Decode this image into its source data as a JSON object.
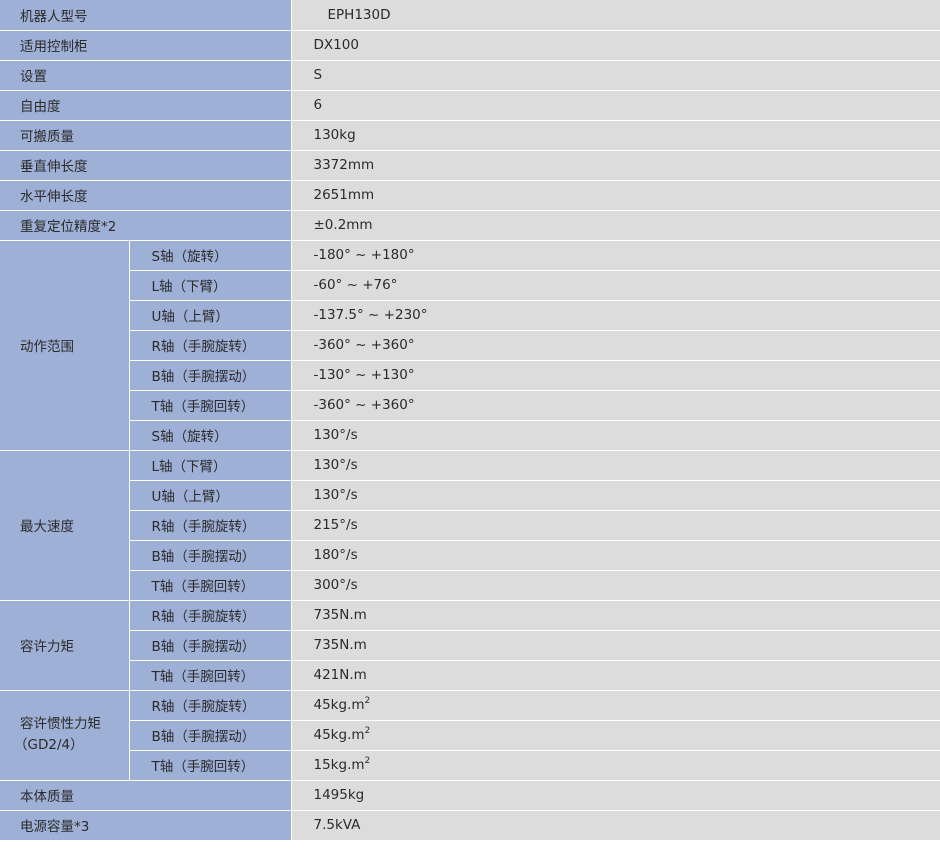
{
  "rows": {
    "model": {
      "label": "机器人型号",
      "value": "EPH130D"
    },
    "controller": {
      "label": "适用控制柜",
      "value": "DX100"
    },
    "mounting": {
      "label": "设置",
      "value": "S"
    },
    "dof": {
      "label": "自由度",
      "value": "6"
    },
    "payload": {
      "label": "可搬质量",
      "value": "130kg"
    },
    "vertical_reach": {
      "label": "垂直伸长度",
      "value": "3372mm"
    },
    "horizontal_reach": {
      "label": "水平伸长度",
      "value": "2651mm"
    },
    "repeatability": {
      "label": "重复定位精度*2",
      "value": "±0.2mm"
    },
    "motion_range": {
      "label": "动作范围",
      "items": [
        {
          "axis": "S轴（旋转）",
          "value": "-180° ~ +180°"
        },
        {
          "axis": "L轴（下臂）",
          "value": "-60° ~ +76°"
        },
        {
          "axis": "U轴（上臂）",
          "value": "-137.5° ~ +230°"
        },
        {
          "axis": "R轴（手腕旋转）",
          "value": "-360° ~ +360°"
        },
        {
          "axis": "B轴（手腕摆动）",
          "value": "-130° ~ +130°"
        },
        {
          "axis": "T轴（手腕回转）",
          "value": "-360° ~ +360°"
        }
      ]
    },
    "max_speed": {
      "label": "最大速度",
      "items": [
        {
          "axis": "S轴（旋转）",
          "value": "130°/s"
        },
        {
          "axis": "L轴（下臂）",
          "value": "130°/s"
        },
        {
          "axis": "U轴（上臂）",
          "value": "130°/s"
        },
        {
          "axis": "R轴（手腕旋转）",
          "value": "215°/s"
        },
        {
          "axis": "B轴（手腕摆动）",
          "value": "180°/s"
        },
        {
          "axis": "T轴（手腕回转）",
          "value": "300°/s"
        }
      ]
    },
    "allowable_moment": {
      "label": "容许力矩",
      "items": [
        {
          "axis": "R轴（手腕旋转）",
          "value": "735N.m"
        },
        {
          "axis": "B轴（手腕摆动）",
          "value": "735N.m"
        },
        {
          "axis": "T轴（手腕回转）",
          "value": "421N.m"
        }
      ]
    },
    "allowable_inertia": {
      "label": "容许惯性力矩",
      "label2": "（GD2/4）",
      "items": [
        {
          "axis": "R轴（手腕旋转）",
          "value": "45kg.m",
          "sup": "2"
        },
        {
          "axis": "B轴（手腕摆动）",
          "value": "45kg.m",
          "sup": "2"
        },
        {
          "axis": "T轴（手腕回转）",
          "value": "15kg.m",
          "sup": "2"
        }
      ]
    },
    "mass": {
      "label": "本体质量",
      "value": "1495kg"
    },
    "power": {
      "label": "电源容量*3",
      "value": "7.5kVA"
    }
  }
}
